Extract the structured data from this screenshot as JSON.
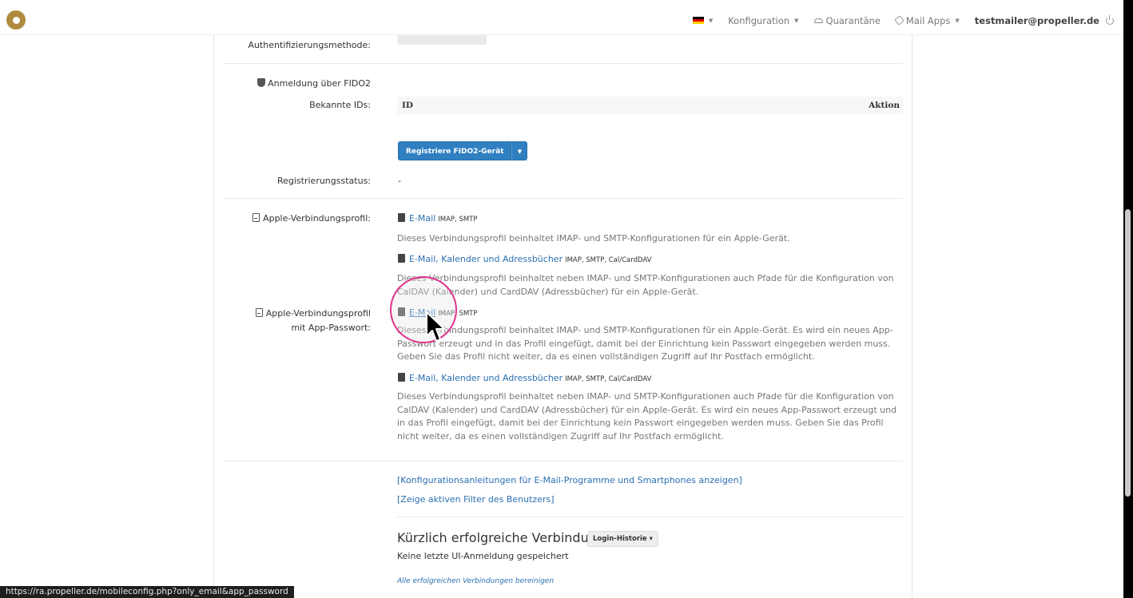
{
  "navbar": {
    "language_flag": "de",
    "config_label": "Konfiguration",
    "quarantine_label": "Quarantäne",
    "mailapps_label": "Mail Apps",
    "user_email": "testmailer@propeller.de"
  },
  "security": {
    "auth_method_label": "Authentifizierungsmethode:",
    "fido_title": "Anmeldung über FIDO2",
    "known_ids_label": "Bekannte IDs:",
    "table_headers": [
      "ID",
      "Aktion"
    ],
    "register_button": "Registriere FIDO2-Gerät",
    "reg_status_label": "Registrierungsstatus:",
    "reg_status_value": "-"
  },
  "apple_profile": {
    "label": "Apple-Verbindungsprofil:",
    "items": [
      {
        "link": "E-Mail",
        "protocols": "IMAP, SMTP",
        "desc": "Dieses Verbindungsprofil beinhaltet IMAP- und SMTP-Konfigurationen für ein Apple-Gerät."
      },
      {
        "link": "E-Mail, Kalender und Adressbücher",
        "protocols": "IMAP, SMTP, Cal/CardDAV",
        "desc": "Dieses Verbindungsprofil beinhaltet neben IMAP- und SMTP-Konfigurationen auch Pfade für die Konfiguration von CalDAV (Kalender) und CardDAV (Adressbücher) für ein Apple-Gerät."
      }
    ]
  },
  "apple_profile_app": {
    "label_line1": "Apple-Verbindungsprofil",
    "label_line2": "mit App-Passwort:",
    "items": [
      {
        "link": "E-Mail",
        "protocols": "IMAP, SMTP",
        "desc": "Dieses Verbindungsprofil beinhaltet IMAP- und SMTP-Konfigurationen für ein Apple-Gerät. Es wird ein neues App-Passwort erzeugt und in das Profil eingefügt, damit bei der Einrichtung kein Passwort eingegeben werden muss. Geben Sie das Profil nicht weiter, da es einen vollständigen Zugriff auf Ihr Postfach ermöglicht."
      },
      {
        "link": "E-Mail, Kalender und Adressbücher",
        "protocols": "IMAP, SMTP, Cal/CardDAV",
        "desc": "Dieses Verbindungsprofil beinhaltet neben IMAP- und SMTP-Konfigurationen auch Pfade für die Konfiguration von CalDAV (Kalender) und CardDAV (Adressbücher) für ein Apple-Gerät. Es wird ein neues App-Passwort erzeugt und in das Profil eingefügt, damit bei der Einrichtung kein Passwort eingegeben werden muss. Geben Sie das Profil nicht weiter, da es einen vollständigen Zugriff auf Ihr Postfach ermöglicht."
      }
    ]
  },
  "links": {
    "config_guides": "[Konfigurationsanleitungen für E-Mail-Programme und Smartphones anzeigen]",
    "active_filters": "[Zeige aktiven Filter des Benutzers]"
  },
  "recent": {
    "heading": "Kürzlich erfolgreiche Verbindungen",
    "history_button": "Login-Historie",
    "no_login_text": "Keine letzte UI-Anmeldung gespeichert",
    "clear_link": "Alle erfolgreichen Verbindungen bereinigen"
  },
  "status_bar": {
    "url": "https://ra.propeller.de/mobileconfig.php?only_email&app_password"
  },
  "colors": {
    "link": "#2a6fb0",
    "button": "#2f7fc1",
    "cursor_ring": "#e0348c",
    "logo": "#b08a3e"
  }
}
